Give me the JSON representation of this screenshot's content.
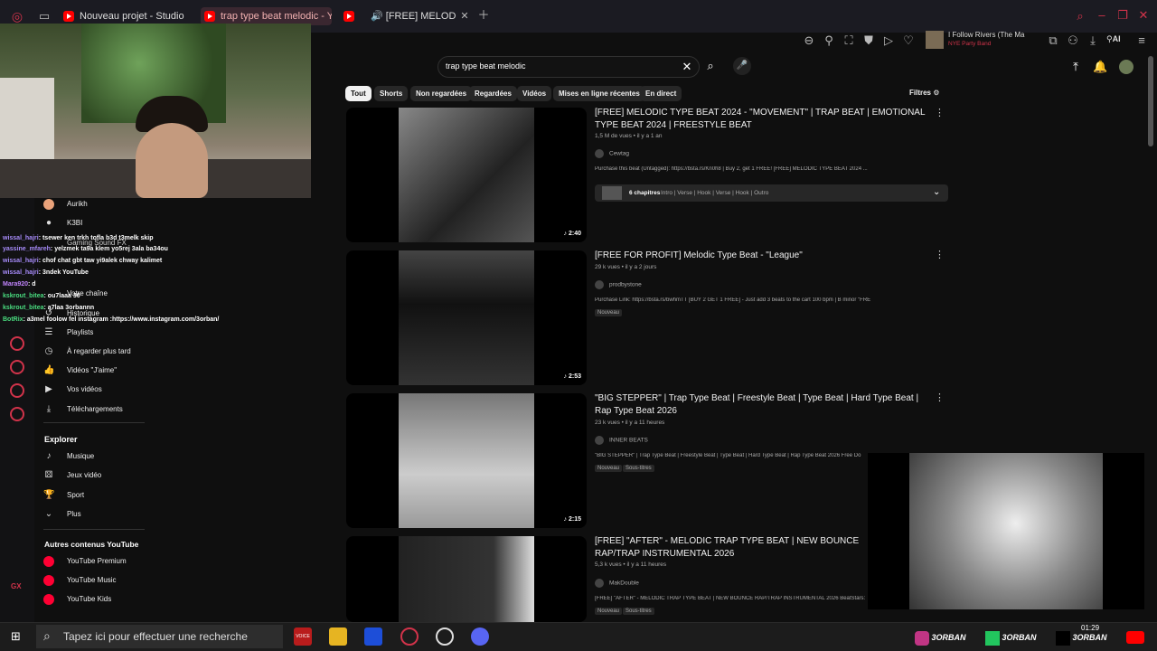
{
  "browser": {
    "tabs": [
      {
        "label": "Nouveau projet - Studio"
      },
      {
        "label": "trap type beat melodic - Yo"
      },
      {
        "label": "[FREE] MELODIC T"
      }
    ],
    "now_playing": {
      "title": "I Follow Rivers (The Ma",
      "artist": "NYE Party Band"
    },
    "ai_label": "AI"
  },
  "search": {
    "query": "trap type beat melodic"
  },
  "filters": {
    "label": "Filtres",
    "chips": [
      "Tout",
      "Shorts",
      "Non regardées",
      "Regardées",
      "Vidéos",
      "Mises en ligne récentes",
      "En direct"
    ]
  },
  "sidebar": {
    "items_top": [
      "Aurikh",
      "K3BI",
      "Gaming Sound FX",
      "Votre chaîne",
      "Historique",
      "Playlists",
      "À regarder plus tard",
      "Vidéos \"J'aime\"",
      "Vos vidéos",
      "Téléchargements"
    ],
    "explorer_title": "Explorer",
    "explorer": [
      "Musique",
      "Jeux vidéo",
      "Sport",
      "Plus"
    ],
    "autres_title": "Autres contenus YouTube",
    "autres": [
      "YouTube Premium",
      "YouTube Music",
      "YouTube Kids"
    ]
  },
  "chat": [
    {
      "user": "wissal_hajri",
      "msg": ": tsewer ken trkh tofla b3d t3melk skip"
    },
    {
      "user": "yassine_mfareh",
      "msg": ": yelzmek ta9a klem yo5rej 3ala ba34ou"
    },
    {
      "user": "wissal_hajri",
      "msg": ": chof chat gbt taw yi9alek chway kalimet"
    },
    {
      "user": "wissal_hajri",
      "msg": ": 3ndek YouTube"
    },
    {
      "user": "Mara920",
      "msg": ": d"
    },
    {
      "user": "kskrout_bitea",
      "msg": ": ou7laaa 30"
    },
    {
      "user": "kskrout_bitea",
      "msg": ": a7laa 3orbannn"
    },
    {
      "user": "BotRix",
      "msg": ": a3mel foolow fel instagram :https://www.instagram.com/3orban/"
    }
  ],
  "results": [
    {
      "title": "[FREE] MELODIC TYPE BEAT 2024 - \"MOVEMENT\" | TRAP BEAT | EMOTIONAL TYPE BEAT 2024 | FREESTYLE BEAT",
      "meta": "1,5 M de vues  •  il y a 1 an",
      "channel": "Cewtag",
      "desc": "Purchase this beat (Untagged): https://bsta.rs/Kn0h8 | Buy 2, get 1 FREE! [FREE] MELODIC TYPE BEAT 2024 ...",
      "duration": "2:40",
      "chapters": "6 chapitres",
      "chapters_desc": "Intro | Verse | Hook | Verse | Hook | Outro"
    },
    {
      "title": "[FREE FOR PROFIT] Melodic Type Beat - \"League\"",
      "meta": "29 k vues  •  il y a 2 jours",
      "channel": "prodbystone",
      "desc": "Purchase Link: https://bsta.rs/bwhmTT [BUY 2 GET 1 FREE] - Just add 3 beats to the cart 100 bpm | B minor \"FREE FOR PROFIT\" ...",
      "duration": "2:53",
      "badges": [
        "Nouveau"
      ]
    },
    {
      "title": "\"BIG STEPPER\" | Trap Type Beat | Freestyle Beat | Type Beat | Hard Type Beat | Rap Type Beat 2026",
      "meta": "23 k vues  •  il y a 11 heures",
      "channel": "INNER BEATS",
      "desc": "\"BIG STEPPER\" | Trap Type Beat | Freestyle Beat | Type Beat | Hard Type Beat | Rap Type Beat 2026 Free Do",
      "duration": "2:15",
      "badges": [
        "Nouveau",
        "Sous-titres"
      ]
    },
    {
      "title": "[FREE] \"AFTER\" - MELODIC TRAP TYPE BEAT | NEW BOUNCE RAP/TRAP INSTRUMENTAL 2026",
      "meta": "5,3 k vues  •  il y a 11 heures",
      "channel": "MakDouble",
      "desc": "[FREE] \"AFTER\" - MELODIC TRAP TYPE BEAT | NEW BOUNCE RAP/TRAP INSTRUMENTAL 2026 BeatStars:",
      "badges": [
        "Nouveau",
        "Sous-titres"
      ]
    }
  ],
  "taskbar": {
    "search_placeholder": "Tapez ici pour effectuer une recherche",
    "clock": "01:29",
    "brand": "3ORBAN",
    "voice_label": "VOICE"
  },
  "side_label": "GX",
  "colors": {
    "accent": "#ff0033",
    "gx": "#d1334a"
  }
}
